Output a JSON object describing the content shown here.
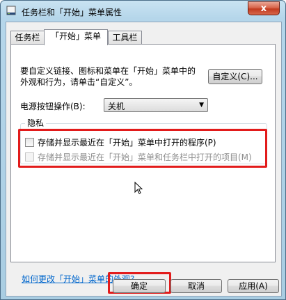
{
  "window": {
    "title": "任务栏和「开始」菜单属性",
    "close_label": "x"
  },
  "tabs": [
    {
      "label": "任务栏"
    },
    {
      "label": "「开始」菜单"
    },
    {
      "label": "工具栏"
    }
  ],
  "start_menu": {
    "description_line1": "要自定义链接、图标和菜单在「开始」菜单中的",
    "description_line2": "外观和行为，请单击“自定义”。",
    "customize_button": "自定义(C)...",
    "power_button_label": "电源按钮操作(B):",
    "power_button_value": "关机",
    "privacy": {
      "title": "隐私",
      "store_programs": "存储并显示最近在「开始」菜单中打开的程序(P)",
      "store_items": "存储并显示最近在「开始」菜单和任务栏中打开的项目(M)"
    },
    "appearance_link": "如何更改「开始」菜单的外观?"
  },
  "footer": {
    "ok": "确定",
    "cancel": "取消",
    "apply": "应用(A)"
  }
}
